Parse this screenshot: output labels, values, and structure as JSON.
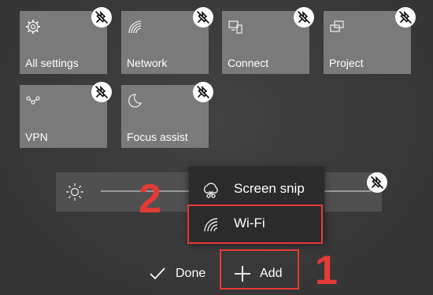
{
  "tiles": [
    {
      "label": "All settings",
      "icon": "gear-icon"
    },
    {
      "label": "Network",
      "icon": "network-icon"
    },
    {
      "label": "Connect",
      "icon": "connect-icon"
    },
    {
      "label": "Project",
      "icon": "project-icon"
    },
    {
      "label": "VPN",
      "icon": "vpn-icon"
    },
    {
      "label": "Focus assist",
      "icon": "moon-icon"
    }
  ],
  "flyout": {
    "items": [
      {
        "label": "Screen snip",
        "icon": "screen-snip-icon"
      },
      {
        "label": "Wi-Fi",
        "icon": "wifi-icon"
      }
    ]
  },
  "bottom_bar": {
    "done_label": "Done",
    "add_label": "Add"
  },
  "annotations": {
    "step_1": "1",
    "step_2": "2",
    "highlight_color": "#e53935"
  },
  "colors": {
    "tile_bg": "#7a7a7a",
    "flyout_bg": "#2b2b2b",
    "background": "#3a3a3a"
  }
}
